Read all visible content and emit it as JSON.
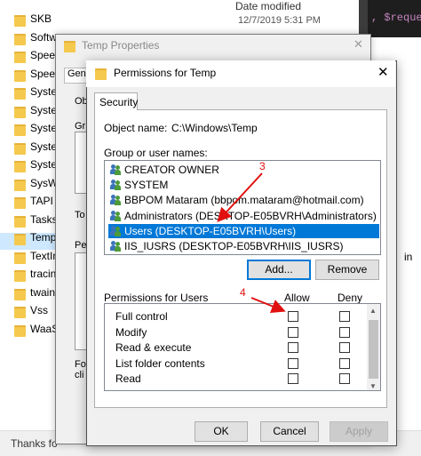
{
  "explorer": {
    "column_header": "Date modified",
    "selected_date": "12/7/2019 5:31 PM",
    "folders": [
      "SKB",
      "Softw",
      "Speec",
      "Speec",
      "Syster",
      "Syster",
      "Syster",
      "Syster",
      "Syster",
      "SysW",
      "TAPI",
      "Tasks",
      "Temp",
      "TextIn",
      "tracin",
      "twain",
      "Vss",
      "WaaS"
    ],
    "selected_folder": "Temp",
    "code_snippet": ", $reque",
    "right_text": "in",
    "status_text": "Thanks fo"
  },
  "properties_dialog": {
    "title": "Temp Properties",
    "tab_label": "Gen",
    "fragment_obj": "Ob",
    "fragment_gr": "Gr",
    "fragment_to": "To",
    "fragment_pe": "Pe",
    "fragment_fo": "Fo",
    "fragment_cli": "cli"
  },
  "permissions_dialog": {
    "title": "Permissions for Temp",
    "close_glyph": "✕",
    "tab": "Security",
    "object_name_label": "Object name:",
    "object_name_value": "C:\\Windows\\Temp",
    "group_label": "Group or user names:",
    "users": [
      "CREATOR OWNER",
      "SYSTEM",
      "BBPOM Mataram (bbpom.mataram@hotmail.com)",
      "Administrators (DESKTOP-E05BVRH\\Administrators)",
      "Users (DESKTOP-E05BVRH\\Users)",
      "IIS_IUSRS (DESKTOP-E05BVRH\\IIS_IUSRS)"
    ],
    "selected_user_index": 4,
    "add_button": "Add...",
    "remove_button": "Remove",
    "permissions_label": "Permissions for Users",
    "allow_header": "Allow",
    "deny_header": "Deny",
    "permissions": [
      {
        "name": "Full control",
        "allow": false,
        "deny": false
      },
      {
        "name": "Modify",
        "allow": false,
        "deny": false
      },
      {
        "name": "Read & execute",
        "allow": false,
        "deny": false
      },
      {
        "name": "List folder contents",
        "allow": false,
        "deny": false
      },
      {
        "name": "Read",
        "allow": false,
        "deny": false
      }
    ],
    "ok_button": "OK",
    "cancel_button": "Cancel",
    "apply_button": "Apply"
  },
  "annotations": {
    "marker_3": "3",
    "marker_4": "4",
    "color": "#e01010"
  },
  "colors": {
    "selection": "#0078d7",
    "folder": "#f5c94d"
  }
}
